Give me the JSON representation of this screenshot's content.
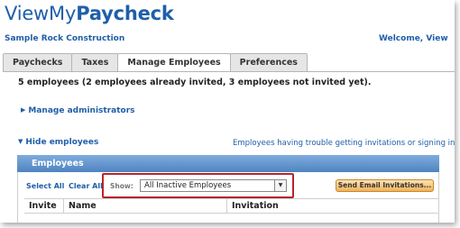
{
  "app": {
    "logo_light": "ViewMy",
    "logo_bold": "Paycheck",
    "company": "Sample Rock Construction",
    "welcome": "Welcome,  View"
  },
  "tabs": [
    {
      "label": "Paychecks",
      "active": false
    },
    {
      "label": "Taxes",
      "active": false
    },
    {
      "label": "Manage Employees",
      "active": true
    },
    {
      "label": "Preferences",
      "active": false
    }
  ],
  "summary": "5 employees (2 employees already invited, 3 employees not invited yet).",
  "links": {
    "manage_admins": "Manage administrators",
    "hide_employees": "Hide employees",
    "trouble": "Employees having trouble getting invitations or signing in?"
  },
  "employees_panel": {
    "title": "Employees",
    "select_all": "Select All",
    "clear_all": "Clear All",
    "show_label": "Show:",
    "show_value": "All Inactive Employees",
    "send_button": "Send Email Invitations...",
    "columns": [
      "Invite",
      "Name",
      "Invitation"
    ]
  },
  "colors": {
    "brand_blue": "#1f5fa8",
    "panel_header": "#5a8fc8",
    "highlight_red": "#b6262a",
    "button_orange": "#f3b25a"
  }
}
